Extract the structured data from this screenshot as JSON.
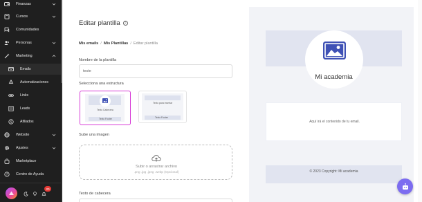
{
  "sidebar": {
    "items": [
      {
        "label": "Finanzas",
        "icon": "wallet-icon"
      },
      {
        "label": "Cursos",
        "icon": "book-icon"
      },
      {
        "label": "Comunidades",
        "icon": "chat-icon"
      },
      {
        "label": "Personas",
        "icon": "people-icon"
      },
      {
        "label": "Marketing",
        "icon": "wand-icon"
      }
    ],
    "marketing_sub": [
      {
        "label": "Emails",
        "icon": "mail-icon"
      },
      {
        "label": "Automatizaciones",
        "icon": "recycle-icon"
      },
      {
        "label": "Links",
        "icon": "link-icon"
      },
      {
        "label": "Leads",
        "icon": "list-icon"
      },
      {
        "label": "Afiliados",
        "icon": "coin-icon"
      }
    ],
    "items_after": [
      {
        "label": "Website",
        "icon": "globe-icon"
      },
      {
        "label": "Ajustes",
        "icon": "gear-icon"
      },
      {
        "label": "Marketplace",
        "icon": "bag-icon"
      },
      {
        "label": "Centro de Ayuda",
        "icon": "question-icon"
      }
    ],
    "notification_count": "20"
  },
  "editor": {
    "title": "Editar plantilla",
    "breadcrumb": [
      "Mis emails",
      "Mis Plantillas",
      "Editar plantilla"
    ],
    "name_label": "Nombre de la plantilla",
    "name_value": "teste",
    "structure_label": "Selecciona una estructura",
    "structures": [
      {
        "header": "Texto Cabecera",
        "footer": "Texto Footer"
      },
      {
        "header": "Texto para insertar",
        "footer": "Texto Footer"
      }
    ],
    "image_label": "Sube una imagen",
    "upload_text": "Subir o arrastrar archivo",
    "upload_hint": ".png .jpg .jpeg .webp (Opcional)",
    "header_text_label": "Texto de cabecera"
  },
  "preview": {
    "academy_name": "Mi academia",
    "body_text": "Aquí irá el contenido de tu email.",
    "footer_text": "© 2023 Copyright: Mi academia",
    "header_color": "#e1e4f0",
    "image_icon_color": "#3f51b5"
  },
  "colors": {
    "sidebar_bg": "#1f1f1f",
    "selected_border": "#d63ad6",
    "fab": "#7c6cf0"
  }
}
